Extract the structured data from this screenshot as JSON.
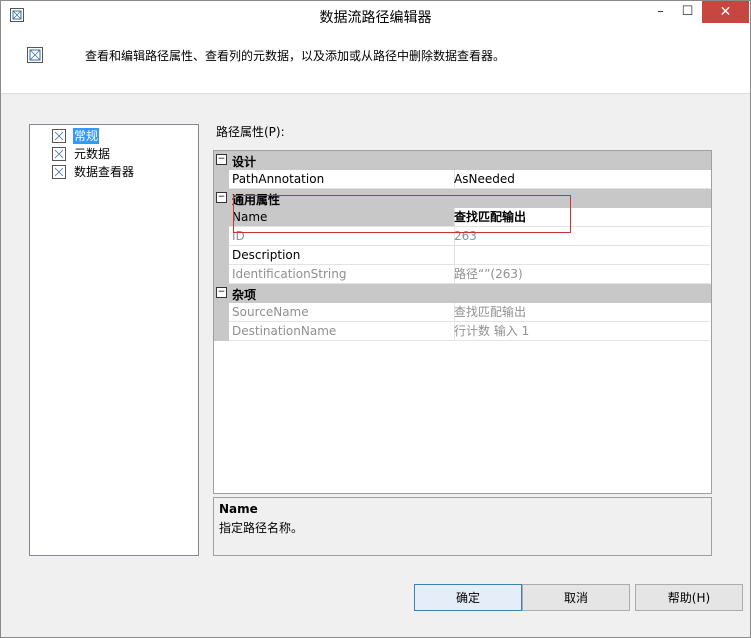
{
  "window": {
    "title": "数据流路径编辑器",
    "min": "–",
    "max": "☐",
    "close": "✕"
  },
  "header": {
    "description": "查看和编辑路径属性、查看列的元数据，以及添加或从路径中删除数据查看器。"
  },
  "nav": {
    "items": [
      {
        "label": "常规",
        "selected": true
      },
      {
        "label": "元数据",
        "selected": false
      },
      {
        "label": "数据查看器",
        "selected": false
      }
    ]
  },
  "props": {
    "label": "路径属性(P):",
    "categories": [
      {
        "name": "设计",
        "toggle": "⊟",
        "rows": [
          {
            "name": "PathAnnotation",
            "value": "AsNeeded",
            "readonly": false
          }
        ]
      },
      {
        "name": "通用属性",
        "toggle": "⊟",
        "rows": [
          {
            "name": "Name",
            "value": "查找匹配输出",
            "readonly": false,
            "selected": true
          },
          {
            "name": "ID",
            "value": "263",
            "readonly": true
          },
          {
            "name": "Description",
            "value": "",
            "readonly": false
          },
          {
            "name": "IdentificationString",
            "value": "路径“”(263)",
            "readonly": true
          }
        ]
      },
      {
        "name": "杂项",
        "toggle": "⊟",
        "rows": [
          {
            "name": "SourceName",
            "value": "查找匹配输出",
            "readonly": true
          },
          {
            "name": "DestinationName",
            "value": "行计数 输入 1",
            "readonly": true
          }
        ]
      }
    ]
  },
  "help": {
    "title": "Name",
    "text": "指定路径名称。"
  },
  "buttons": {
    "ok": "确定",
    "cancel": "取消",
    "help": "帮助(H)"
  },
  "colors": {
    "selection": "#3399ff",
    "highlight_border": "#d03030",
    "close_button": "#c7463f"
  }
}
